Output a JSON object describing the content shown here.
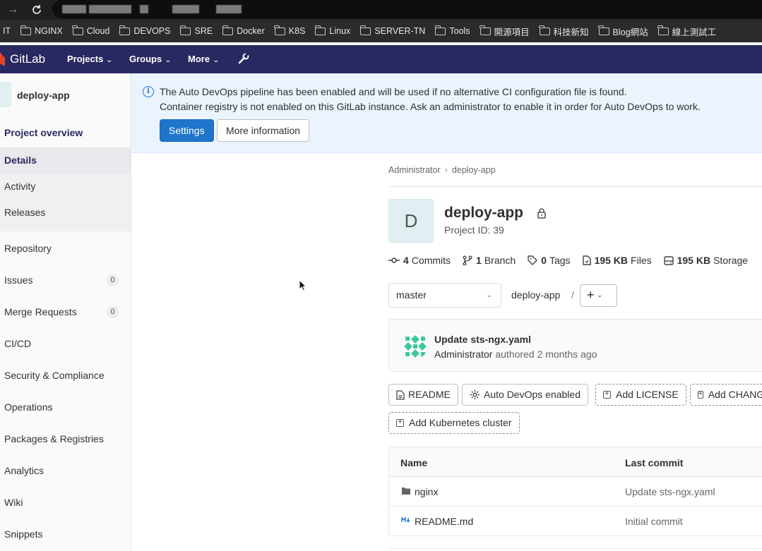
{
  "bookmarks": [
    "IT",
    "NGINX",
    "Cloud",
    "DEVOPS",
    "SRE",
    "Docker",
    "K8S",
    "Linux",
    "SERVER-TN",
    "Tools",
    "開源項目",
    "科技新知",
    "Blog網站",
    "線上測試工"
  ],
  "header": {
    "brand": "GitLab",
    "nav": [
      "Projects",
      "Groups",
      "More"
    ]
  },
  "sidebar": {
    "project_name": "deploy-app",
    "overview": "Project overview",
    "sub_items": [
      "Details",
      "Activity",
      "Releases"
    ],
    "items": [
      {
        "label": "Repository"
      },
      {
        "label": "Issues",
        "count": "0"
      },
      {
        "label": "Merge Requests",
        "count": "0"
      },
      {
        "label": "CI/CD"
      },
      {
        "label": "Security & Compliance"
      },
      {
        "label": "Operations"
      },
      {
        "label": "Packages & Registries"
      },
      {
        "label": "Analytics"
      },
      {
        "label": "Wiki"
      },
      {
        "label": "Snippets"
      }
    ]
  },
  "alert": {
    "line1": "The Auto DevOps pipeline has been enabled and will be used if no alternative CI configuration file is found.",
    "line2": "Container registry is not enabled on this GitLab instance. Ask an administrator to enable it in order for Auto DevOps to work.",
    "settings_label": "Settings",
    "more_info_label": "More information"
  },
  "breadcrumb": {
    "root": "Administrator",
    "current": "deploy-app"
  },
  "project": {
    "initial": "D",
    "title": "deploy-app",
    "project_id": "Project ID: 39"
  },
  "stats": {
    "commits_count": "4",
    "commits_label": "Commits",
    "branch_count": "1",
    "branch_label": "Branch",
    "tags_count": "0",
    "tags_label": "Tags",
    "files_size": "195 KB",
    "files_label": "Files",
    "storage_size": "195 KB",
    "storage_label": "Storage"
  },
  "repo_nav": {
    "branch": "master",
    "path": "deploy-app",
    "slash": "/"
  },
  "last_commit": {
    "title": "Update sts-ngx.yaml",
    "author": "Administrator",
    "meta": "authored 2 months ago"
  },
  "actions": {
    "readme": "README",
    "auto_devops": "Auto DevOps enabled",
    "add_license": "Add LICENSE",
    "add_changelog": "Add CHANGELOG",
    "add_k8s": "Add Kubernetes cluster"
  },
  "file_table": {
    "col_name": "Name",
    "col_last_commit": "Last commit",
    "rows": [
      {
        "name": "nginx",
        "last_commit": "Update sts-ngx.yaml",
        "type": "folder"
      },
      {
        "name": "README.md",
        "last_commit": "Initial commit",
        "type": "markdown"
      }
    ]
  },
  "colors": {
    "header_bg": "#292961",
    "primary": "#1f75cb",
    "alert_bg": "#ebf4fd"
  }
}
